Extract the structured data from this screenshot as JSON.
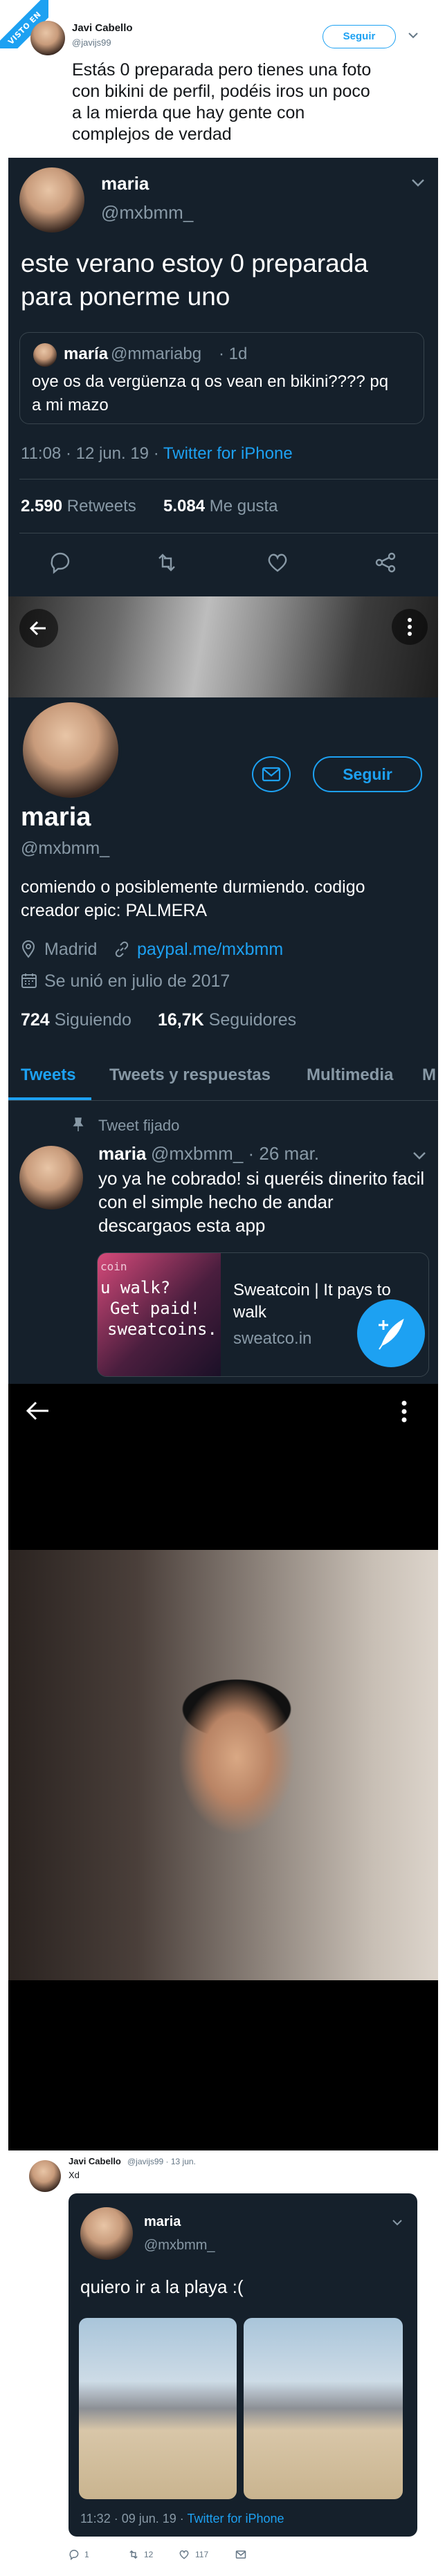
{
  "ribbon": "VISTO EN CUANTARAZON",
  "top_tweet": {
    "name": "Javi Cabello",
    "handle": "@javijs99",
    "follow": "Seguir",
    "text_lines": [
      "Estás 0 preparada pero tienes una foto",
      "con bikini de perfil, podéis iros un poco",
      "a la mierda que hay gente con",
      "complejos de verdad"
    ]
  },
  "dark_tweet": {
    "name": "maria",
    "handle": "@mxbmm_",
    "text_lines": [
      "este verano estoy 0 preparada",
      "para ponerme uno"
    ],
    "quote": {
      "name": "maría",
      "handle": "@mmariabg",
      "time": "· 1d",
      "lines": [
        "oye os da vergüenza q os vean en bikini???? pq",
        "a mi mazo"
      ]
    },
    "timestamp": "11:08 · 12 jun. 19 · ",
    "source": "Twitter for iPhone",
    "retweets_count": "2.590",
    "retweets_label": "Retweets",
    "likes_count": "5.084",
    "likes_label": "Me gusta"
  },
  "profile": {
    "follow": "Seguir",
    "name": "maria",
    "handle": "@mxbmm_",
    "bio_lines": [
      "comiendo o posiblemente durmiendo. codigo",
      "creador epic: PALMERA"
    ],
    "location": "Madrid",
    "link": "paypal.me/mxbmm",
    "joined": "Se unió en julio de 2017",
    "following_count": "724",
    "following_label": "Siguiendo",
    "followers_count": "16,7K",
    "followers_label": "Seguidores",
    "tabs": [
      "Tweets",
      "Tweets y respuestas",
      "Multimedia",
      "M"
    ],
    "pinned_label": "Tweet fijado",
    "pinned": {
      "name": "maria",
      "handle_time": "@mxbmm_ · 26 mar.",
      "lines": [
        "yo ya he cobrado! si queréis dinerito facil",
        "con el simple hecho de andar",
        "descargaos esta app"
      ],
      "card_title_lines": [
        "Sweatcoin | It pays to",
        "walk"
      ],
      "card_domain": "sweatco.in",
      "card_image_lines": [
        "coin",
        "u walk?",
        "Get paid!",
        "sweatcoins."
      ]
    }
  },
  "reply_tweet": {
    "name": "Javi Cabello",
    "handle_time": "@javijs99 · 13 jun.",
    "text": "Xd",
    "inner": {
      "name": "maria",
      "handle": "@mxbmm_",
      "text": "quiero ir a la playa :(",
      "timestamp": "11:32 · 09 jun. 19 · ",
      "source": "Twitter for iPhone"
    },
    "replies": "1",
    "retweets": "12",
    "likes": "117"
  },
  "colors": {
    "twitter_blue": "#1da1f2",
    "dark_bg": "#15202b",
    "muted": "#8899a6"
  }
}
